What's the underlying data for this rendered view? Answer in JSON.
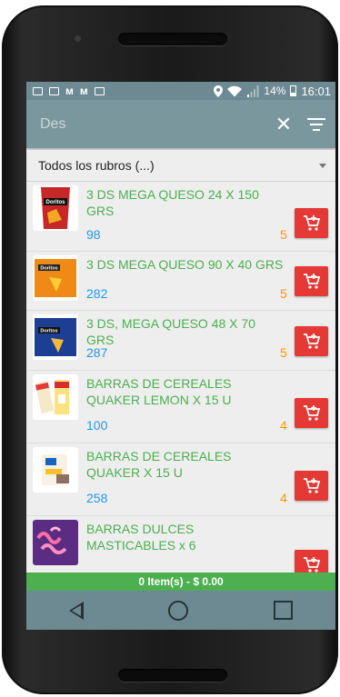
{
  "status_bar": {
    "battery": "14%",
    "time": "16:01",
    "notification_icons": [
      "image-icon",
      "mail-icon",
      "m-icon",
      "m-icon",
      "mail-icon"
    ]
  },
  "search": {
    "value": "Des",
    "placeholder": ""
  },
  "category": {
    "selected": "Todos los rubros (...)"
  },
  "products": [
    {
      "name": "3 DS MEGA QUESO 24 X 150 GRS",
      "stock": "98",
      "qty": "5",
      "thumb": "doritos-red"
    },
    {
      "name": "3 DS MEGA QUESO 90 X 40 GRS",
      "stock": "282",
      "qty": "5",
      "thumb": "doritos-orange"
    },
    {
      "name": "3 DS, MEGA QUESO 48 X 70 GRS",
      "stock": "287",
      "qty": "5",
      "thumb": "doritos-blue"
    },
    {
      "name": "BARRAS DE CEREALES QUAKER LEMON  X 15 U",
      "stock": "100",
      "qty": "4",
      "thumb": "quaker-bars"
    },
    {
      "name": "BARRAS DE CEREALES QUAKER X 15 U",
      "stock": "258",
      "qty": "4",
      "thumb": "quaker-box"
    },
    {
      "name": "BARRAS DULCES MASTICABLES x 6",
      "stock": "",
      "qty": "",
      "thumb": "gummy"
    }
  ],
  "footer": {
    "summary": "0 Item(s) - $ 0.00"
  },
  "colors": {
    "green": "#4caf50",
    "blue": "#2196f3",
    "orange": "#ff9800",
    "red": "#e53935",
    "toolbar": "#7b979e"
  }
}
